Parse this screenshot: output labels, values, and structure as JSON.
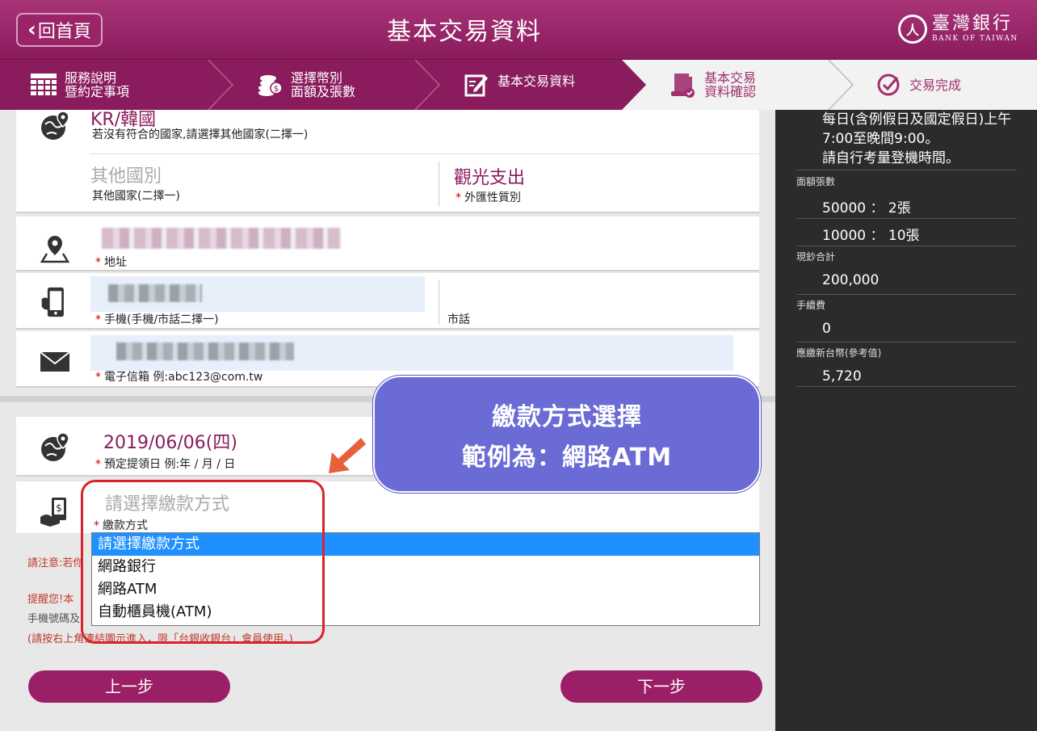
{
  "header": {
    "home_label": "回首頁",
    "title": "基本交易資料",
    "logo_cn": "臺灣銀行",
    "logo_en": "BANK OF TAIWAN",
    "logo_mark": "人"
  },
  "steps": [
    {
      "label": "服務說明\n暨約定事項",
      "icon": "grid-icon"
    },
    {
      "label": "選擇幣別\n面額及張數",
      "icon": "coins-icon"
    },
    {
      "label": "基本交易資料",
      "icon": "edit-form-icon"
    },
    {
      "label": "基本交易\n資料確認",
      "icon": "document-check-icon"
    },
    {
      "label": "交易完成",
      "icon": "checkmark-circle-icon"
    }
  ],
  "colors": {
    "brand": "#8a1b5c",
    "accent": "#9b1f66",
    "callout": "#6b6bd6",
    "selected": "#1e90ff",
    "highlight": "#d8232a"
  },
  "form": {
    "country_value": "KR/韓國",
    "country_hint": "若沒有符合的國家,請選擇其他國家(二擇一)",
    "other_country_value": "其他國別",
    "other_country_label": "其他國家(二擇一)",
    "purpose_value": "觀光支出",
    "purpose_label": "外匯性質別",
    "address_label": "地址",
    "mobile_label": "手機(手機/市話二擇一)",
    "phone_label": "市話",
    "email_label": "電子信箱 例:abc123@com.tw",
    "date_value": "2019/06/06(四)",
    "date_label": "預定提領日 例:年 / 月 / 日",
    "payment_placeholder": "請選擇繳款方式",
    "payment_label": "繳款方式",
    "required_mark": "*"
  },
  "payment_options": [
    "請選擇繳款方式",
    "網路銀行",
    "網路ATM",
    "自動櫃員機(ATM)"
  ],
  "notes": {
    "note1": "請注意:若你",
    "note2": "提醒您!本",
    "note3": "手機號碼及",
    "note4": "(請按右上角連結圖示進入，限「台銀收銀台」會員使用。)"
  },
  "callout": {
    "line1": "繳款方式選擇",
    "line2": "範例為：網路ATM"
  },
  "buttons": {
    "prev": "上一步",
    "next": "下一步"
  },
  "summary": {
    "hours_line1": "每日(含例假日及國定假日)上午",
    "hours_line2": "7:00至晚間9:00。",
    "hours_line3": "請自行考量登機時間。",
    "denom_label": "面額張數",
    "denom1": "50000 ： 2張",
    "denom2": "10000 ： 10張",
    "cash_total_label": "現鈔合計",
    "cash_total": "200,000",
    "fee_label": "手續費",
    "fee": "0",
    "twd_label": "應繳新台幣(參考值)",
    "twd": "5,720"
  }
}
